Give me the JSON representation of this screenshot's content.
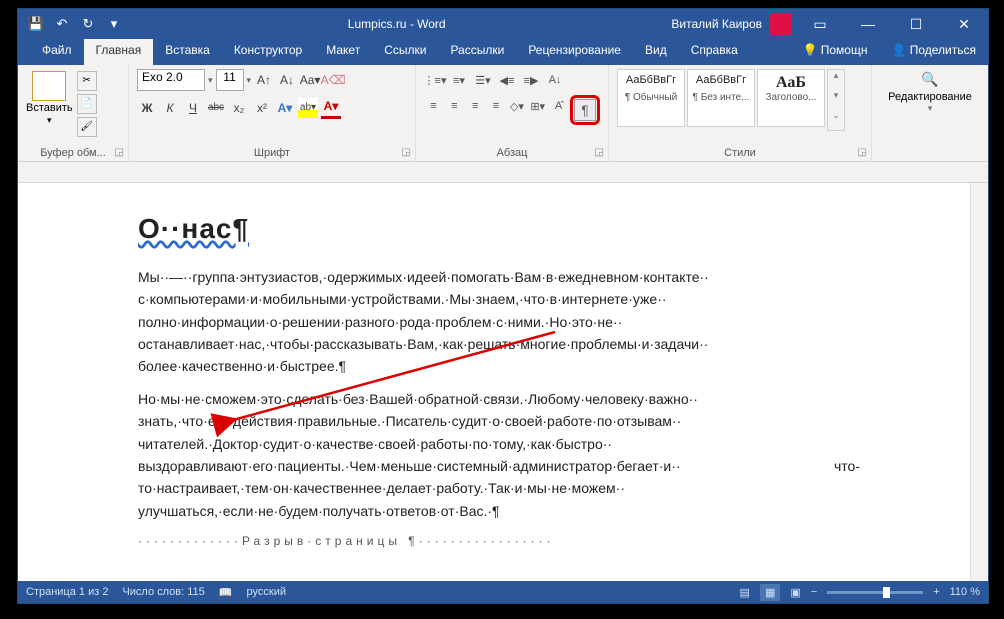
{
  "title": "Lumpics.ru  -  Word",
  "user": "Виталий Каиров",
  "tabs": {
    "file": "Файл",
    "home": "Главная",
    "insert": "Вставка",
    "design": "Конструктор",
    "layout": "Макет",
    "refs": "Ссылки",
    "mail": "Рассылки",
    "review": "Рецензирование",
    "view": "Вид",
    "help": "Справка",
    "assist": "Помощн",
    "share": "Поделиться"
  },
  "clipboard": {
    "label": "Буфер обм...",
    "paste": "Вставить"
  },
  "font": {
    "label": "Шрифт",
    "name": "Exo 2.0",
    "size": "11",
    "bold": "Ж",
    "italic": "К",
    "underline": "Ч",
    "strike": "abc",
    "sub": "x₂",
    "sup": "x²"
  },
  "paragraph": {
    "label": "Абзац"
  },
  "styles": {
    "label": "Стили",
    "preview": "АаБбВвГг",
    "s1": "¶ Обычный",
    "s2": "¶ Без инте...",
    "s3_prev": "АаБ",
    "s3": "Заголово..."
  },
  "editing": {
    "label": "Редактирование"
  },
  "doc": {
    "heading": "О··нас¶",
    "p1": "Мы··—··группа·энтузиастов,·одержимых·идеей·помогать·Вам·в·ежедневном·контакте·· с·компьютерами·и·мобильными·устройствами.·Мы·знаем,·что·в·интернете·уже·· полно·информации·о·решении·разного·рода·проблем·с·ними.·Но·это·не·· останавливает·нас,·чтобы·рассказывать·Вам,·как·решать·многие·проблемы·и·задачи·· более·качественно·и·быстрее.¶",
    "p2": "Но·мы·не·сможем·это·сделать·без·Вашей·обратной·связи.·Любому·человеку·важно·· знать,·что·его·действия·правильные.·Писатель·судит·о·своей·работе·по·отзывам·· читателей.·Доктор·судит·о·качестве·своей·работы·по·тому,·как·быстро·· выздоравливают·его·пациенты.·Чем·меньше·системный·администратор·бегает·и·· что-то·настраивает,·тем·он·качественнее·делает·работу.·Так·и·мы·не·можем·· улучшаться,·если·не·будем·получать·ответов·от·Вас.·¶",
    "break": "Разрыв·страницы ¶"
  },
  "status": {
    "page": "Страница 1 из 2",
    "words": "Число слов: 115",
    "lang": "русский",
    "zoom": "110 %"
  }
}
